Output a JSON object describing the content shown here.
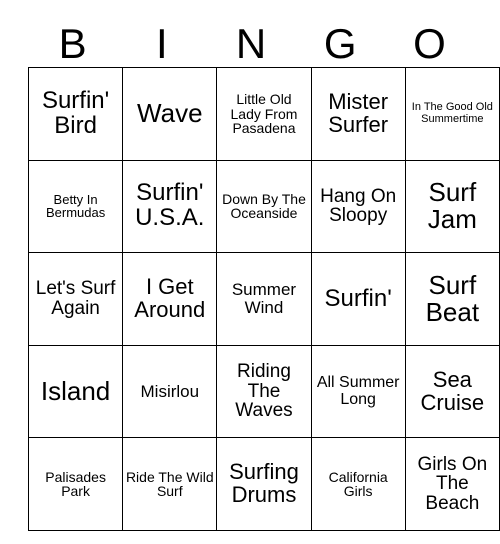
{
  "card": {
    "title": "BINGO",
    "columns": [
      "B",
      "I",
      "N",
      "G",
      "O"
    ],
    "rows": [
      [
        {
          "text": "Surfin' Bird",
          "size": "xxl"
        },
        {
          "text": "Wave",
          "size": "huge"
        },
        {
          "text": "Little Old Lady From Pasadena",
          "size": "sm"
        },
        {
          "text": "Mister Surfer",
          "size": "xl"
        },
        {
          "text": "In The Good Old Summertime",
          "size": "xs"
        }
      ],
      [
        {
          "text": "Betty In Bermudas",
          "size": "s"
        },
        {
          "text": "Surfin' U.S.A.",
          "size": "xxl"
        },
        {
          "text": "Down By The Oceanside",
          "size": "sm"
        },
        {
          "text": "Hang On Sloopy",
          "size": "l"
        },
        {
          "text": "Surf Jam",
          "size": "huge"
        }
      ],
      [
        {
          "text": "Let's Surf Again",
          "size": "l"
        },
        {
          "text": "I Get Around",
          "size": "xl"
        },
        {
          "text": "Summer Wind",
          "size": "ml"
        },
        {
          "text": "Surfin'",
          "size": "xxl"
        },
        {
          "text": "Surf Beat",
          "size": "huge"
        }
      ],
      [
        {
          "text": "Island",
          "size": "huge"
        },
        {
          "text": "Misirlou",
          "size": "ml"
        },
        {
          "text": "Riding The Waves",
          "size": "l"
        },
        {
          "text": "All Summer Long",
          "size": "m"
        },
        {
          "text": "Sea Cruise",
          "size": "xl"
        }
      ],
      [
        {
          "text": "Palisades Park",
          "size": "sm"
        },
        {
          "text": "Ride The Wild Surf",
          "size": "sm"
        },
        {
          "text": "Surfing Drums",
          "size": "xl"
        },
        {
          "text": "California Girls",
          "size": "sm"
        },
        {
          "text": "Girls On The Beach",
          "size": "l"
        }
      ]
    ]
  }
}
